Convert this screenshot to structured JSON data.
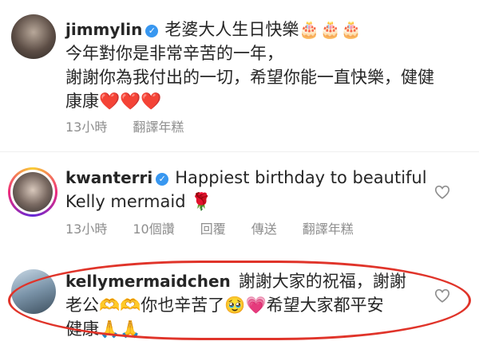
{
  "comments": [
    {
      "username": "jimmylin",
      "verified": true,
      "lines": [
        "老婆大人生日快樂",
        "今年對你是非常辛苦的一年，",
        "謝謝你為我付出的一切，希望你能一直快樂，健健",
        "康康"
      ],
      "emoji_line1": "🎂🎂🎂",
      "emoji_line4": "❤️❤️❤️",
      "time": "13小時",
      "translate": "翻譯年糕"
    },
    {
      "username": "kwanterri",
      "verified": true,
      "lines": [
        "Happiest birthday to beautiful",
        "Kelly mermaid"
      ],
      "emoji_line2": "🌹",
      "time": "13小時",
      "likes": "10個讚",
      "reply": "回覆",
      "send": "傳送",
      "translate": "翻譯年糕"
    },
    {
      "username": "kellymermaidchen",
      "verified": false,
      "lines": [
        "謝謝大家的祝福，謝謝",
        "老公",
        "你也辛苦了",
        "希望大家都平安",
        "健康"
      ],
      "emoji_a": "🫶🫶",
      "emoji_b": "🥹💗",
      "emoji_c": "🙏🙏"
    }
  ],
  "icons": {
    "verified": "verified-badge-icon",
    "like": "heart-outline-icon"
  },
  "colors": {
    "verified": "#3897f0",
    "meta": "#8e8e8e",
    "annotation": "#e0342a"
  }
}
